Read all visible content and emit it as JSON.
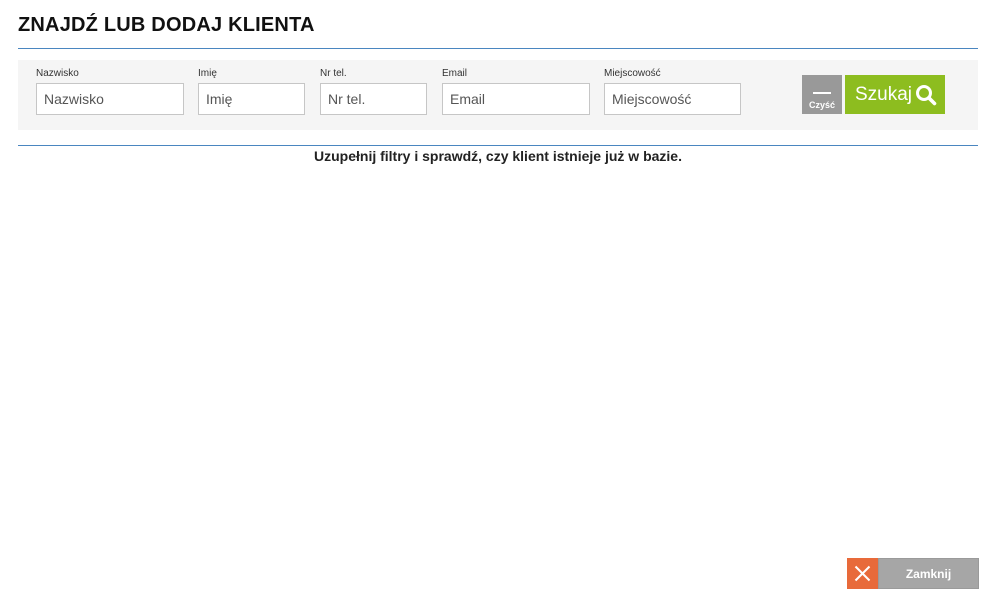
{
  "page": {
    "title": "ZNAJDŹ LUB DODAJ KLIENTA"
  },
  "filters": {
    "nazwisko": {
      "label": "Nazwisko",
      "placeholder": "Nazwisko",
      "value": ""
    },
    "imie": {
      "label": "Imię",
      "placeholder": "Imię",
      "value": ""
    },
    "tel": {
      "label": "Nr tel.",
      "placeholder": "Nr tel.",
      "value": ""
    },
    "email": {
      "label": "Email",
      "placeholder": "Email",
      "value": ""
    },
    "miejscowosc": {
      "label": "Miejscowość",
      "placeholder": "Miejscowość",
      "value": ""
    }
  },
  "actions": {
    "clear_label": "Czyść",
    "search_label": "Szukaj"
  },
  "message": "Uzupełnij filtry i sprawdź, czy klient istnieje już w bazie.",
  "footer": {
    "close_label": "Zamknij"
  },
  "colors": {
    "accent_rule": "#4a86c0",
    "search_button": "#8dbd1f",
    "clear_button": "#999999",
    "close_icon_bg": "#e86a3a",
    "close_button": "#a6a6a6"
  },
  "icons": {
    "search": "magnifier",
    "clear": "minus",
    "close": "x"
  }
}
